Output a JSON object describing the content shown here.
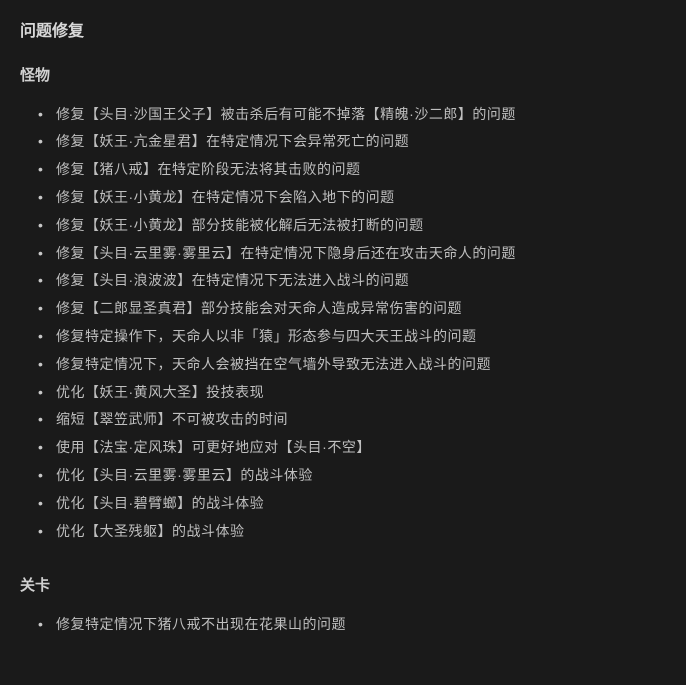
{
  "title": "问题修复",
  "sections": [
    {
      "heading": "怪物",
      "items": [
        "修复【头目·沙国王父子】被击杀后有可能不掉落【精魄·沙二郎】的问题",
        "修复【妖王·亢金星君】在特定情况下会异常死亡的问题",
        "修复【猪八戒】在特定阶段无法将其击败的问题",
        "修复【妖王·小黄龙】在特定情况下会陷入地下的问题",
        "修复【妖王·小黄龙】部分技能被化解后无法被打断的问题",
        "修复【头目·云里雾·雾里云】在特定情况下隐身后还在攻击天命人的问题",
        "修复【头目·浪波波】在特定情况下无法进入战斗的问题",
        "修复【二郎显圣真君】部分技能会对天命人造成异常伤害的问题",
        "修复特定操作下，天命人以非「猿」形态参与四大天王战斗的问题",
        "修复特定情况下，天命人会被挡在空气墙外导致无法进入战斗的问题",
        "优化【妖王·黄风大圣】投技表现",
        "缩短【翠笠武师】不可被攻击的时间",
        "使用【法宝·定风珠】可更好地应对【头目·不空】",
        "优化【头目·云里雾·雾里云】的战斗体验",
        "优化【头目·碧臂螂】的战斗体验",
        "优化【大圣残躯】的战斗体验"
      ]
    },
    {
      "heading": "关卡",
      "items": [
        "修复特定情况下猪八戒不出现在花果山的问题"
      ]
    }
  ]
}
